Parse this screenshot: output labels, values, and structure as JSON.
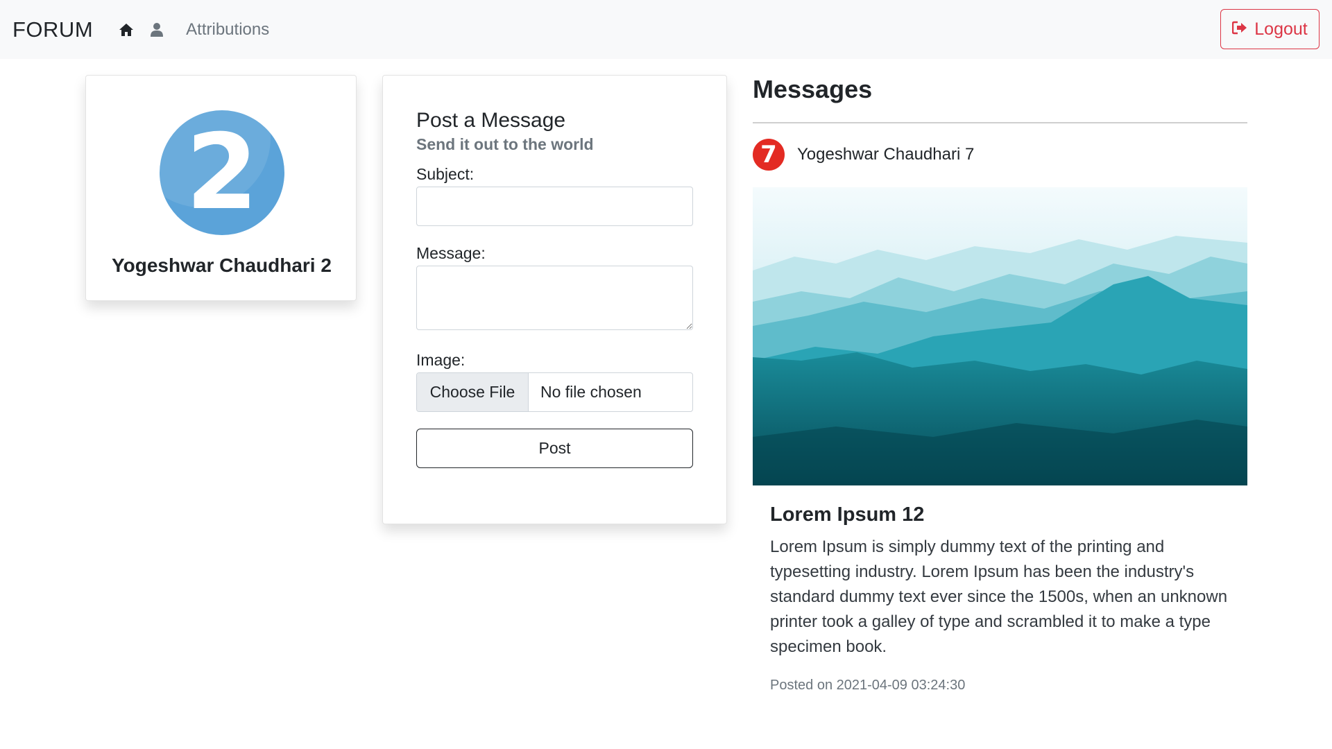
{
  "navbar": {
    "brand": "FORUM",
    "home_icon": "home-icon",
    "user_icon": "user-icon",
    "attributions_label": "Attributions",
    "logout_label": "Logout",
    "logout_icon": "sign-out-icon"
  },
  "profile": {
    "avatar_digit": "2",
    "avatar_color": "#5ba3d9",
    "name": "Yogeshwar Chaudhari 2"
  },
  "post_form": {
    "title": "Post a Message",
    "subtitle": "Send it out to the world",
    "subject_label": "Subject:",
    "subject_value": "",
    "message_label": "Message:",
    "message_value": "",
    "image_label": "Image:",
    "choose_file_label": "Choose File",
    "file_status": "No file chosen",
    "post_label": "Post"
  },
  "messages": {
    "heading": "Messages",
    "items": [
      {
        "author_avatar_digit": "7",
        "author_avatar_color": "#e32b23",
        "author_name": "Yogeshwar Chaudhari 7",
        "title": "Lorem Ipsum 12",
        "text": "Lorem Ipsum is simply dummy text of the printing and typesetting industry. Lorem Ipsum has been the industry's standard dummy text ever since the 1500s, when an unknown printer took a galley of type and scrambled it to make a type specimen book.",
        "posted_on": "Posted on 2021-04-09 03:24:30"
      }
    ]
  },
  "colors": {
    "navbar_bg": "#f8f9fa",
    "danger": "#dc3545",
    "muted": "#6c757d"
  }
}
